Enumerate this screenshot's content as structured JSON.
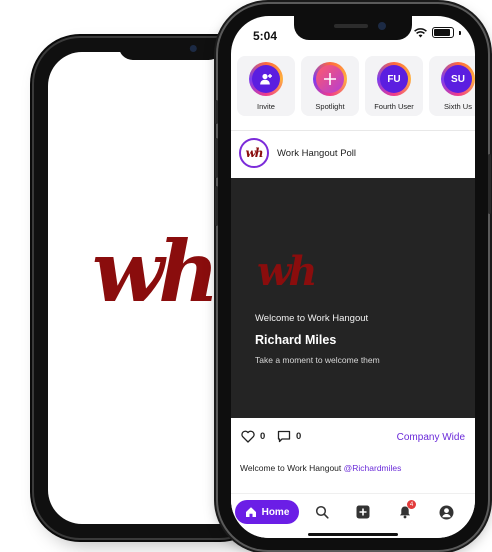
{
  "splash": {
    "logo_text": "wh"
  },
  "status": {
    "time": "5:04"
  },
  "stories": [
    {
      "label": "Invite",
      "initials": "",
      "icon": "add-user-icon"
    },
    {
      "label": "Spotlight",
      "initials": "",
      "icon": "plus-icon"
    },
    {
      "label": "Fourth User",
      "initials": "FU"
    },
    {
      "label": "Sixth Us",
      "initials": "SU"
    }
  ],
  "post": {
    "avatar_text": "wh",
    "title": "Work Hangout Poll",
    "banner": {
      "logo_text": "wh",
      "welcome": "Welcome to Work Hangout",
      "name": "Richard Miles",
      "subtitle": "Take a moment to welcome them"
    },
    "likes": "0",
    "comments": "0",
    "audience": "Company Wide",
    "caption_prefix": "Welcome to Work Hangout",
    "caption_mention": "@Richardmiles"
  },
  "nav": {
    "home_label": "Home",
    "notification_count": "4"
  },
  "colors": {
    "accent": "#6b1ee6",
    "brand_red": "#8a0d0d",
    "banner_bg": "#242424"
  }
}
